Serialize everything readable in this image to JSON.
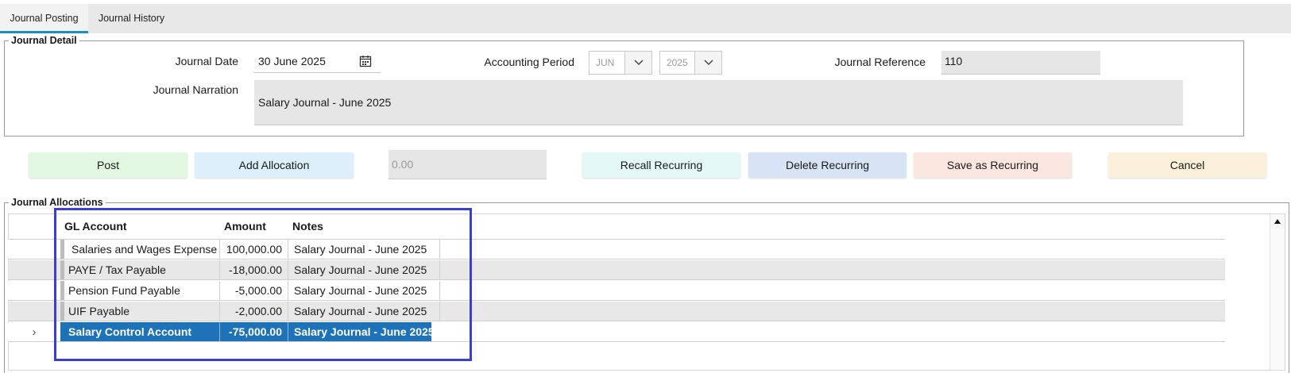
{
  "tabs": [
    {
      "label": "Journal Posting",
      "active": true
    },
    {
      "label": "Journal History",
      "active": false
    }
  ],
  "journal_detail": {
    "legend": "Journal Detail",
    "date_label": "Journal Date",
    "date_value": "30 June 2025",
    "period_label": "Accounting Period",
    "period_month": "JUN",
    "period_year": "2025",
    "reference_label": "Journal Reference",
    "reference_value": "110",
    "narration_label": "Journal Narration",
    "narration_value": "Salary Journal - June 2025"
  },
  "actions": {
    "post": "Post",
    "add_allocation": "Add Allocation",
    "total_value": "0.00",
    "recall_recurring": "Recall Recurring",
    "delete_recurring": "Delete Recurring",
    "save_recurring": "Save as Recurring",
    "cancel": "Cancel"
  },
  "allocations": {
    "legend": "Journal Allocations",
    "columns": {
      "account": "GL Account",
      "amount": "Amount",
      "notes": "Notes"
    },
    "rows": [
      {
        "account": "Salaries and Wages Expense",
        "amount": "100,000.00",
        "notes": "Salary Journal - June 2025"
      },
      {
        "account": "PAYE / Tax Payable",
        "amount": "-18,000.00",
        "notes": "Salary Journal - June 2025"
      },
      {
        "account": "Pension Fund Payable",
        "amount": "-5,000.00",
        "notes": "Salary Journal - June 2025"
      },
      {
        "account": "UIF Payable",
        "amount": "-2,000.00",
        "notes": "Salary Journal - June 2025"
      },
      {
        "account": "Salary Control Account",
        "amount": "-75,000.00",
        "notes": "Salary Journal - June 2025",
        "selected": true
      }
    ],
    "current_row_marker": "›"
  },
  "icons": {
    "calendar": "calendar-icon",
    "dropdown": "chevron-down-icon",
    "scroll_up": "scroll-up-arrow-icon"
  },
  "colors": {
    "tab_accent": "#1a8fc7",
    "post_btn": "#e2f8e0",
    "add_alloc_btn": "#ddeffa",
    "recall_btn": "#e4f8f6",
    "delete_btn": "#d6e4f6",
    "save_btn": "#fbe6e0",
    "cancel_btn": "#fbf0da",
    "selection": "#1e73b8",
    "highlight_box": "#3a3fcc"
  }
}
